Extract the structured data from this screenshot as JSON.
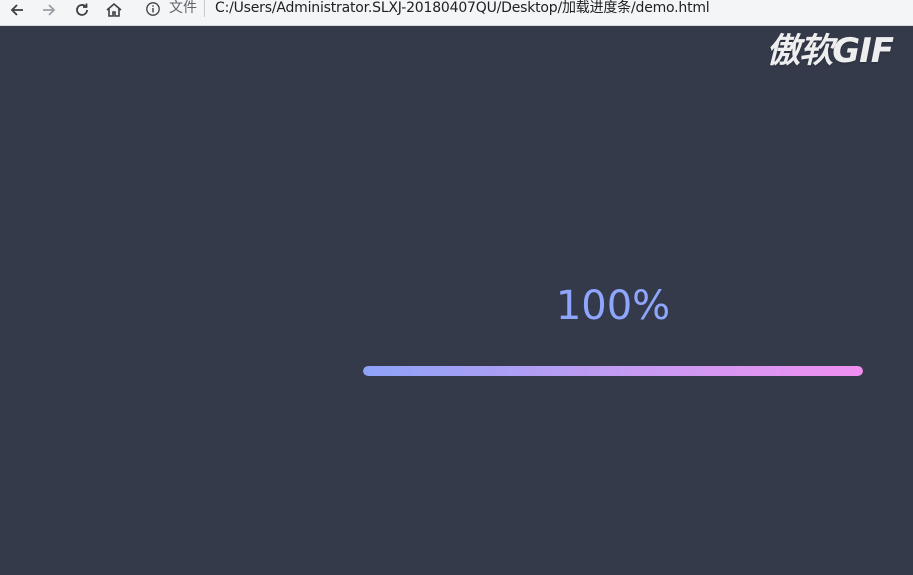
{
  "browser": {
    "file_label": "文件",
    "url": "C:/Users/Administrator.SLXJ-20180407QU/Desktop/加载进度条/demo.html",
    "icons": [
      "back-arrow-icon",
      "forward-arrow-icon",
      "reload-icon",
      "home-icon",
      "info-icon"
    ]
  },
  "watermark": {
    "text": "傲软GIF"
  },
  "progress": {
    "label": "100%",
    "value": 1.0,
    "gradient_start": "#8da3f8",
    "gradient_end": "#f18ff0",
    "label_color": "#8fa6ff"
  },
  "page": {
    "background": "#353a4a"
  }
}
